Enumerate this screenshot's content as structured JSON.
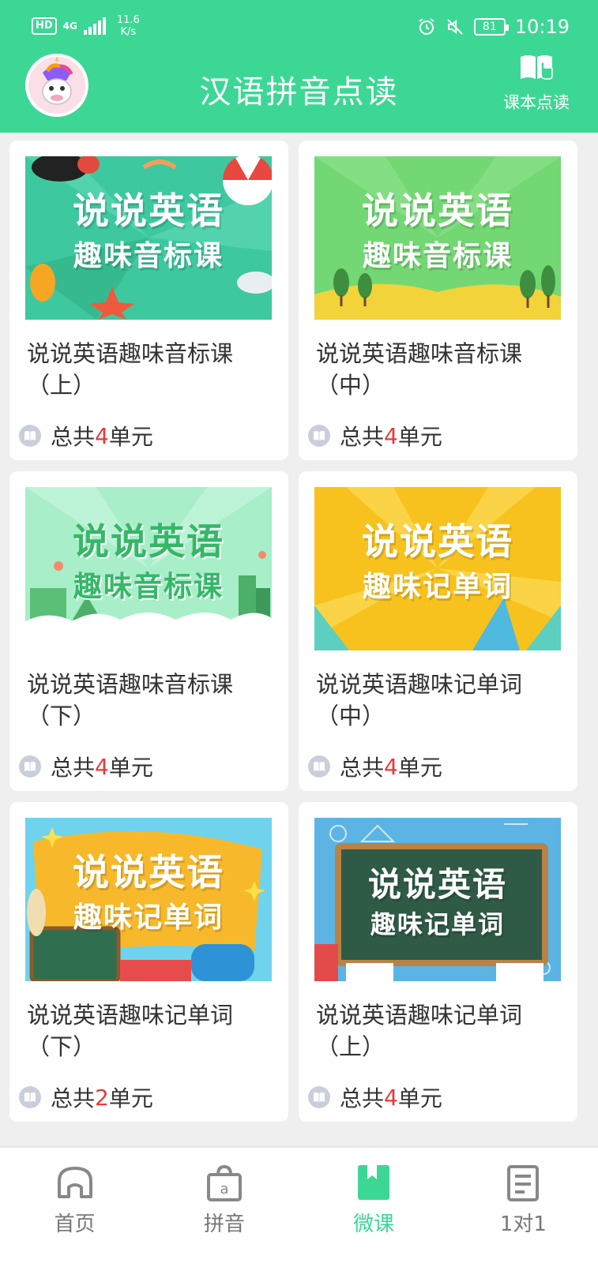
{
  "status_bar": {
    "hd": "HD",
    "network": "4G",
    "speed_value": "11.6",
    "speed_unit": "K/s",
    "battery": "81",
    "time": "10:19"
  },
  "header": {
    "title": "汉语拼音点读",
    "textbook_label": "课本点读",
    "bg_color": "#3dd795"
  },
  "courses": [
    {
      "thumb_title": "说说英语",
      "thumb_sub": "趣味音标课",
      "title": "说说英语趣味音标课（上）",
      "prefix": "总共",
      "count": "4",
      "suffix": "单元"
    },
    {
      "thumb_title": "说说英语",
      "thumb_sub": "趣味音标课",
      "title": "说说英语趣味音标课（中）",
      "prefix": "总共",
      "count": "4",
      "suffix": "单元"
    },
    {
      "thumb_title": "说说英语",
      "thumb_sub": "趣味音标课",
      "title": "说说英语趣味音标课（下）",
      "prefix": "总共",
      "count": "4",
      "suffix": "单元"
    },
    {
      "thumb_title": "说说英语",
      "thumb_sub": "趣味记单词",
      "title": "说说英语趣味记单词（中）",
      "prefix": "总共",
      "count": "4",
      "suffix": "单元"
    },
    {
      "thumb_title": "说说英语",
      "thumb_sub": "趣味记单词",
      "title": "说说英语趣味记单词（下）",
      "prefix": "总共",
      "count": "2",
      "suffix": "单元"
    },
    {
      "thumb_title": "说说英语",
      "thumb_sub": "趣味记单词",
      "title": "说说英语趣味记单词（上）",
      "prefix": "总共",
      "count": "4",
      "suffix": "单元"
    }
  ],
  "tabs": [
    {
      "label": "首页",
      "icon": "home-icon"
    },
    {
      "label": "拼音",
      "icon": "pinyin-icon"
    },
    {
      "label": "微课",
      "icon": "micro-lesson-icon",
      "active": true
    },
    {
      "label": "1对1",
      "icon": "one-on-one-icon"
    }
  ],
  "colors": {
    "accent": "#3dd795",
    "count": "#e63a3a"
  }
}
